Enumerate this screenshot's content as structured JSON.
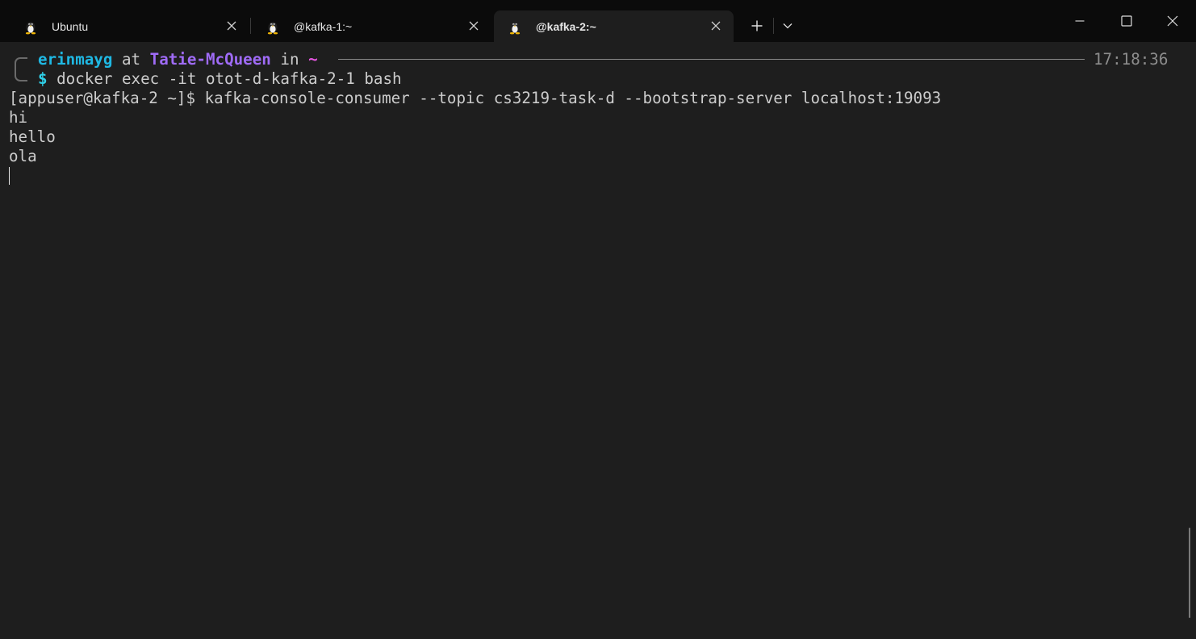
{
  "tabs": [
    {
      "label": "Ubuntu"
    },
    {
      "label": "@kafka-1:~"
    },
    {
      "label": "@kafka-2:~"
    }
  ],
  "prompt": {
    "user": "erinmayg",
    "at": "at",
    "host": "Tatie-McQueen",
    "in": "in",
    "dir": "~",
    "time": "17:18:36",
    "dollar": "$",
    "command": "docker exec -it otot-d-kafka-2-1 bash"
  },
  "output_lines": [
    "[appuser@kafka-2 ~]$ kafka-console-consumer --topic cs3219-task-d --bootstrap-server localhost:19093",
    "hi",
    "hello",
    "ola"
  ],
  "colors": {
    "background": "#1e1e1e",
    "titlebar": "#0b0b0b",
    "user": "#1fb8e3",
    "host": "#9f6bf6",
    "tilde": "#e556e0",
    "dollar": "#2fd0e8"
  },
  "icons": {
    "tab_icon": "tux-linux-icon",
    "close": "close-icon",
    "new_tab": "plus-icon",
    "dropdown": "chevron-down-icon",
    "minimize": "minimize-icon",
    "maximize": "maximize-icon",
    "window_close": "window-close-icon"
  }
}
